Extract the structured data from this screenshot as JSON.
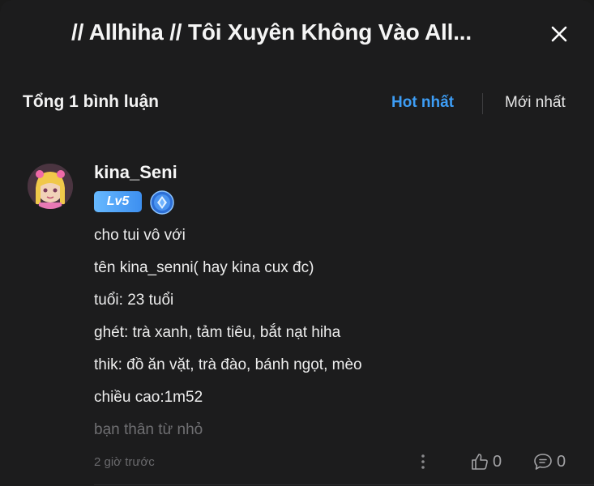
{
  "header": {
    "title": "// Allhiha // Tôi Xuyên Không Vào All...",
    "close_icon": "close-icon"
  },
  "toolbar": {
    "total_label": "Tổng 1 bình luận",
    "sort_hot": "Hot nhất",
    "sort_new": "Mới nhất",
    "active_sort_color": "#3d9df5"
  },
  "comment": {
    "username": "kina_Seni",
    "level_badge": "Lv5",
    "badge_icon": "shield-icon",
    "lines": [
      "cho tui vô với",
      "tên kina_senni( hay kina cux đc)",
      "tuổi: 23 tuổi",
      "ghét: trà xanh, tảm tiêu, bắt nạt hiha",
      "thik: đồ ăn vặt, trà đào, bánh ngọt, mèo",
      "chiều cao:1m52",
      "bạn thân từ nhỏ"
    ],
    "time": "2 giờ trước",
    "likes": "0",
    "replies": "0",
    "more_icon": "more-vertical-icon",
    "like_icon": "thumbs-up-icon",
    "reply_icon": "comment-icon"
  }
}
